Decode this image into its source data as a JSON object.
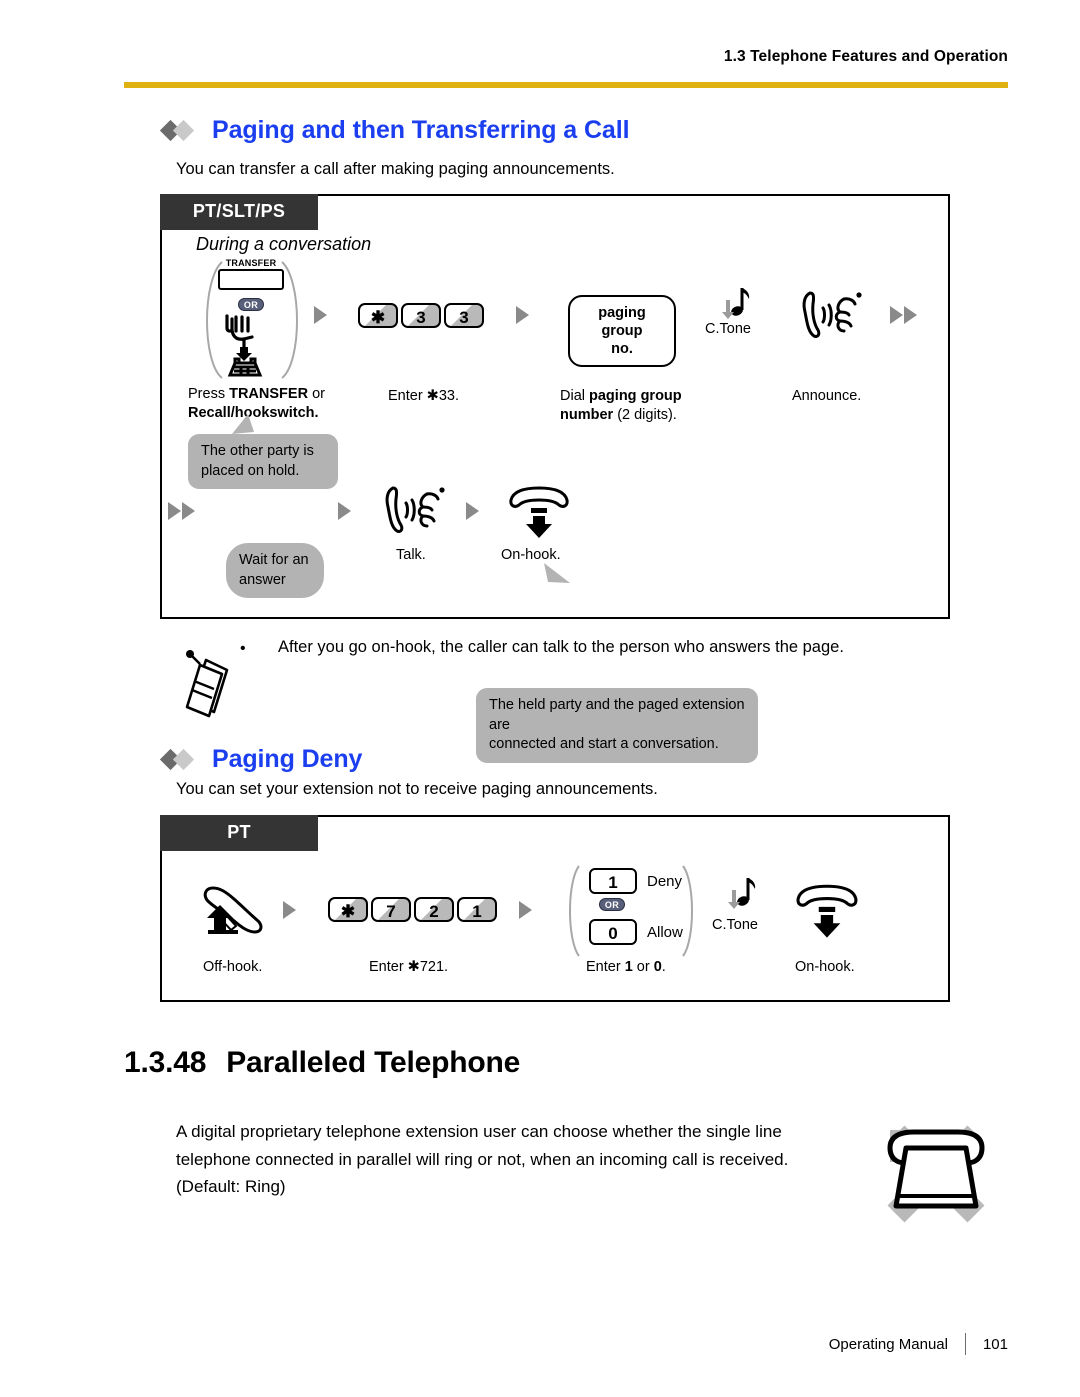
{
  "header": {
    "chapter_title": "1.3 Telephone Features and Operation",
    "rule_color": "#e0b113"
  },
  "features": [
    {
      "title": "Paging and then Transferring a Call",
      "description": "You can transfer a call after making paging announcements.",
      "phone_types": "PT/SLT/PS",
      "box_caption": "During a conversation",
      "steps": {
        "softkey_label": "TRANSFER",
        "or_badge": "OR",
        "step1_label_line1_prefix": "Press ",
        "step1_label_line1_bold": "TRANSFER",
        "step1_label_line1_suffix": " or",
        "step1_label_line2": "Recall/hookswitch.",
        "keys_33": [
          "✱",
          "3",
          "3"
        ],
        "step2_label": "Enter ✱33.",
        "field_line1": "paging group",
        "field_line2": "no.",
        "step3_prefix": "Dial ",
        "step3_bold": "paging group number",
        "step3_suffix": " (2 digits).",
        "ctone_label": "C.Tone",
        "announce_label": "Announce.",
        "callout_hold_line1": "The other party is",
        "callout_hold_line2": "placed on hold.",
        "wait_pill_line1": "Wait for an",
        "wait_pill_line2": "answer",
        "talk_label": "Talk.",
        "onhook_label": "On-hook.",
        "callout_connected_line1": "The held party and the paged extension are",
        "callout_connected_line2": "connected and start a conversation."
      },
      "note_bullet": "After you go on-hook, the caller can talk to the person who answers the page."
    },
    {
      "title": "Paging Deny",
      "description": "You can set your extension not to receive paging announcements.",
      "phone_types": "PT",
      "steps": {
        "offhook_label": "Off-hook.",
        "keys_721": [
          "✱",
          "7",
          "2",
          "1"
        ],
        "enter_label": "Enter ✱721.",
        "deny_key": "1",
        "deny_text": "Deny",
        "or_badge": "OR",
        "allow_key": "0",
        "allow_text": "Allow",
        "enter_choice_prefix": "Enter ",
        "enter_choice_a": "1",
        "enter_choice_mid": " or ",
        "enter_choice_b": "0",
        "enter_choice_suffix": ".",
        "ctone_label": "C.Tone",
        "onhook_label": "On-hook."
      }
    }
  ],
  "section": {
    "number": "1.3.48",
    "title": "Paralleled Telephone",
    "body_line1": "A digital proprietary telephone extension user can choose whether the single line",
    "body_line2": "telephone connected in parallel will ring or not, when an incoming call is received.",
    "body_line3": "(Default: Ring)"
  },
  "footer": {
    "manual_name": "Operating Manual",
    "page_number": "101"
  }
}
